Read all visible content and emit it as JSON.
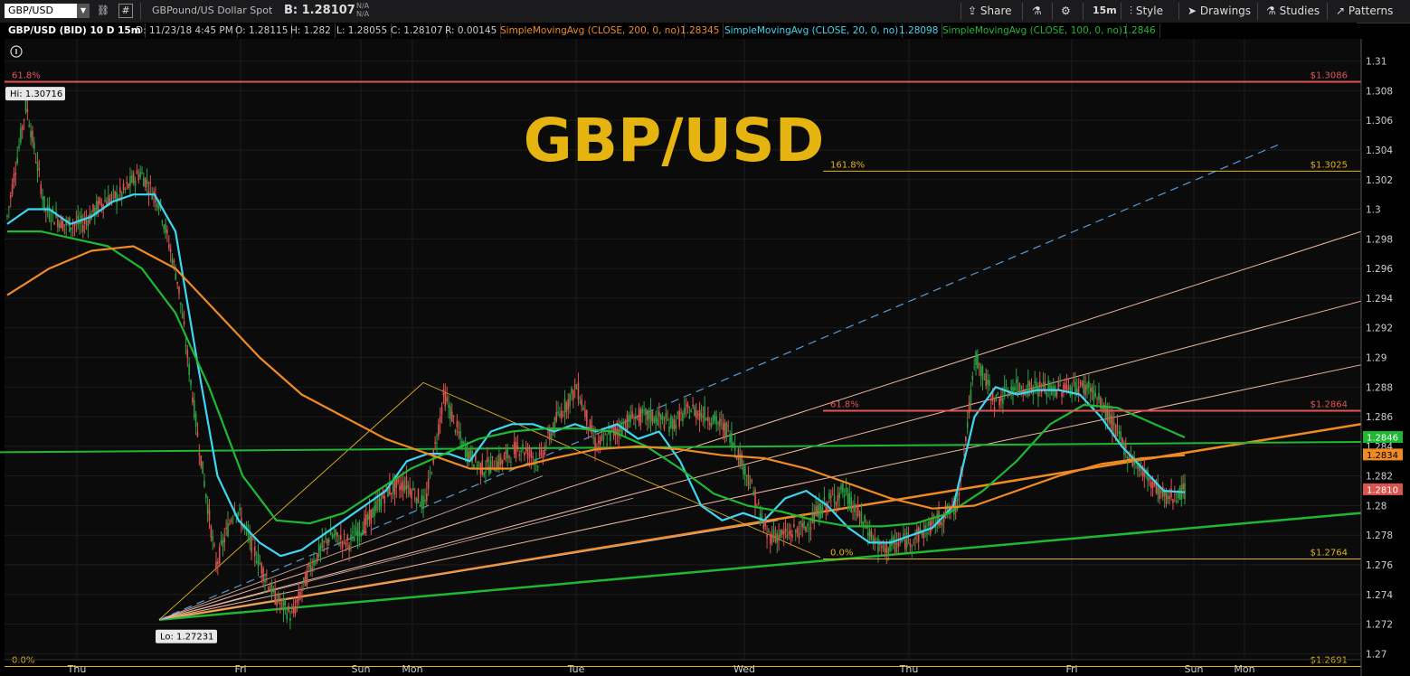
{
  "toolbar": {
    "symbol": "GBP/USD",
    "description": "GBPound/US Dollar Spot",
    "bid_label": "B: 1.28107",
    "na1": "N/A",
    "na2": "N/A",
    "share": "Share",
    "timeframe": "15m",
    "style": "Style",
    "drawings": "Drawings",
    "studies": "Studies",
    "patterns": "Patterns"
  },
  "infobar": {
    "title": "GBP/USD (BID) 10 D 15m",
    "date": "D: 11/23/18 4:45 PM",
    "open": "O: 1.28115",
    "high": "H: 1.282",
    "low": "L: 1.28055",
    "close": "C: 1.28107",
    "range": "R: 0.00145",
    "sma200_label": "SimpleMovingAvg (CLOSE, 200, 0, no)",
    "sma200_value": "1.28345",
    "sma20_label": "SimpleMovingAvg (CLOSE, 20, 0, no)",
    "sma20_value": "1.28098",
    "sma100_label": "SimpleMovingAvg (CLOSE, 100, 0, no)",
    "sma100_value": "1.2846"
  },
  "colors": {
    "sma200": "#f08a24",
    "sma20": "#3fd6f2",
    "sma100": "#1fb832",
    "fib_red": "#e05555",
    "fib_gold": "#e3b21c",
    "title_gold": "#e6b410",
    "candle_up": "#2ea043",
    "candle_down": "#d9534f"
  },
  "chart_data": {
    "type": "line",
    "title": "GBP/USD",
    "x_ticks": [
      "Thu",
      "Fri",
      "Sun",
      "Mon",
      "Tue",
      "Wed",
      "Thu",
      "Fri",
      "Sun",
      "Mon"
    ],
    "y_ticks": [
      1.27,
      1.272,
      1.274,
      1.276,
      1.278,
      1.28,
      1.282,
      1.284,
      1.286,
      1.288,
      1.29,
      1.292,
      1.294,
      1.296,
      1.298,
      1.3,
      1.302,
      1.304,
      1.306,
      1.308,
      1.31
    ],
    "ylim": [
      1.2685,
      1.3115
    ],
    "hi_label": "Hi: 1.30716",
    "lo_label": "Lo: 1.27231",
    "price_series": [
      1.2995,
      1.3071,
      1.3,
      1.299,
      1.299,
      1.3005,
      1.301,
      1.3025,
      1.3005,
      1.295,
      1.285,
      1.276,
      1.28,
      1.277,
      1.274,
      1.2725,
      1.276,
      1.278,
      1.2775,
      1.279,
      1.281,
      1.2815,
      1.28,
      1.2875,
      1.284,
      1.2825,
      1.283,
      1.284,
      1.283,
      1.286,
      1.288,
      1.284,
      1.285,
      1.286,
      1.286,
      1.2855,
      1.2865,
      1.286,
      1.285,
      1.282,
      1.278,
      1.278,
      1.2785,
      1.28,
      1.281,
      1.279,
      1.277,
      1.2775,
      1.278,
      1.279,
      1.28,
      1.29,
      1.287,
      1.288,
      1.288,
      1.2878,
      1.288,
      1.288,
      1.286,
      1.2835,
      1.282,
      1.2805,
      1.281
    ],
    "series": [
      {
        "name": "SimpleMovingAvg (CLOSE, 20, 0, no)",
        "values": [
          1.299,
          1.3,
          1.3,
          1.299,
          1.2995,
          1.3005,
          1.301,
          1.301,
          1.2985,
          1.29,
          1.282,
          1.279,
          1.2775,
          1.2766,
          1.277,
          1.278,
          1.279,
          1.28,
          1.281,
          1.283,
          1.2835,
          1.2835,
          1.283,
          1.285,
          1.2855,
          1.2855,
          1.285,
          1.2855,
          1.285,
          1.2855,
          1.2845,
          1.285,
          1.283,
          1.28,
          1.279,
          1.2795,
          1.279,
          1.2805,
          1.281,
          1.28,
          1.2785,
          1.2775,
          1.2775,
          1.278,
          1.2785,
          1.28,
          1.286,
          1.288,
          1.2875,
          1.2878,
          1.2878,
          1.2875,
          1.286,
          1.284,
          1.2825,
          1.281,
          1.2809
        ]
      },
      {
        "name": "SimpleMovingAvg (CLOSE, 100, 0, no)",
        "values": [
          1.2985,
          1.2985,
          1.298,
          1.2975,
          1.296,
          1.293,
          1.288,
          1.282,
          1.279,
          1.2788,
          1.2795,
          1.281,
          1.2825,
          1.2835,
          1.2845,
          1.285,
          1.2852,
          1.2852,
          1.285,
          1.284,
          1.2825,
          1.2808,
          1.28,
          1.2796,
          1.279,
          1.2786,
          1.2786,
          1.2788,
          1.2795,
          1.281,
          1.283,
          1.2855,
          1.2868,
          1.2866,
          1.2856,
          1.2846
        ]
      },
      {
        "name": "SimpleMovingAvg (CLOSE, 200, 0, no)",
        "values": [
          1.2942,
          1.296,
          1.2972,
          1.2975,
          1.296,
          1.293,
          1.29,
          1.2875,
          1.286,
          1.2845,
          1.2835,
          1.2825,
          1.2825,
          1.2832,
          1.2838,
          1.284,
          1.2838,
          1.2834,
          1.2832,
          1.2825,
          1.2815,
          1.2805,
          1.2798,
          1.28,
          1.281,
          1.282,
          1.2828,
          1.2832,
          1.2834
        ]
      }
    ],
    "fib_levels": [
      {
        "pct": "61.8%",
        "price": "$1.3086",
        "value": 1.3086,
        "color": "red"
      },
      {
        "pct": "161.8%",
        "price": "$1.3025",
        "value": 1.30257,
        "color": "gold"
      },
      {
        "pct": "61.8%",
        "price": "$1.2864",
        "value": 1.2864,
        "color": "red"
      },
      {
        "pct": "0.0%",
        "price": "$1.2764",
        "value": 1.2764,
        "color": "gold"
      },
      {
        "pct": "0.0%",
        "price": "$1.2691",
        "value": 1.26914,
        "color": "gold"
      }
    ],
    "price_tags": [
      {
        "text": "1.2846",
        "value": 1.2846,
        "bg": "#1fb832",
        "fg": "#ffffff"
      },
      {
        "text": "1.2834",
        "value": 1.28342,
        "bg": "#f08a24",
        "fg": "#000000"
      },
      {
        "text": "1.2810",
        "value": 1.28107,
        "bg": "#d9534f",
        "fg": "#ffffff"
      }
    ],
    "grid": true
  }
}
